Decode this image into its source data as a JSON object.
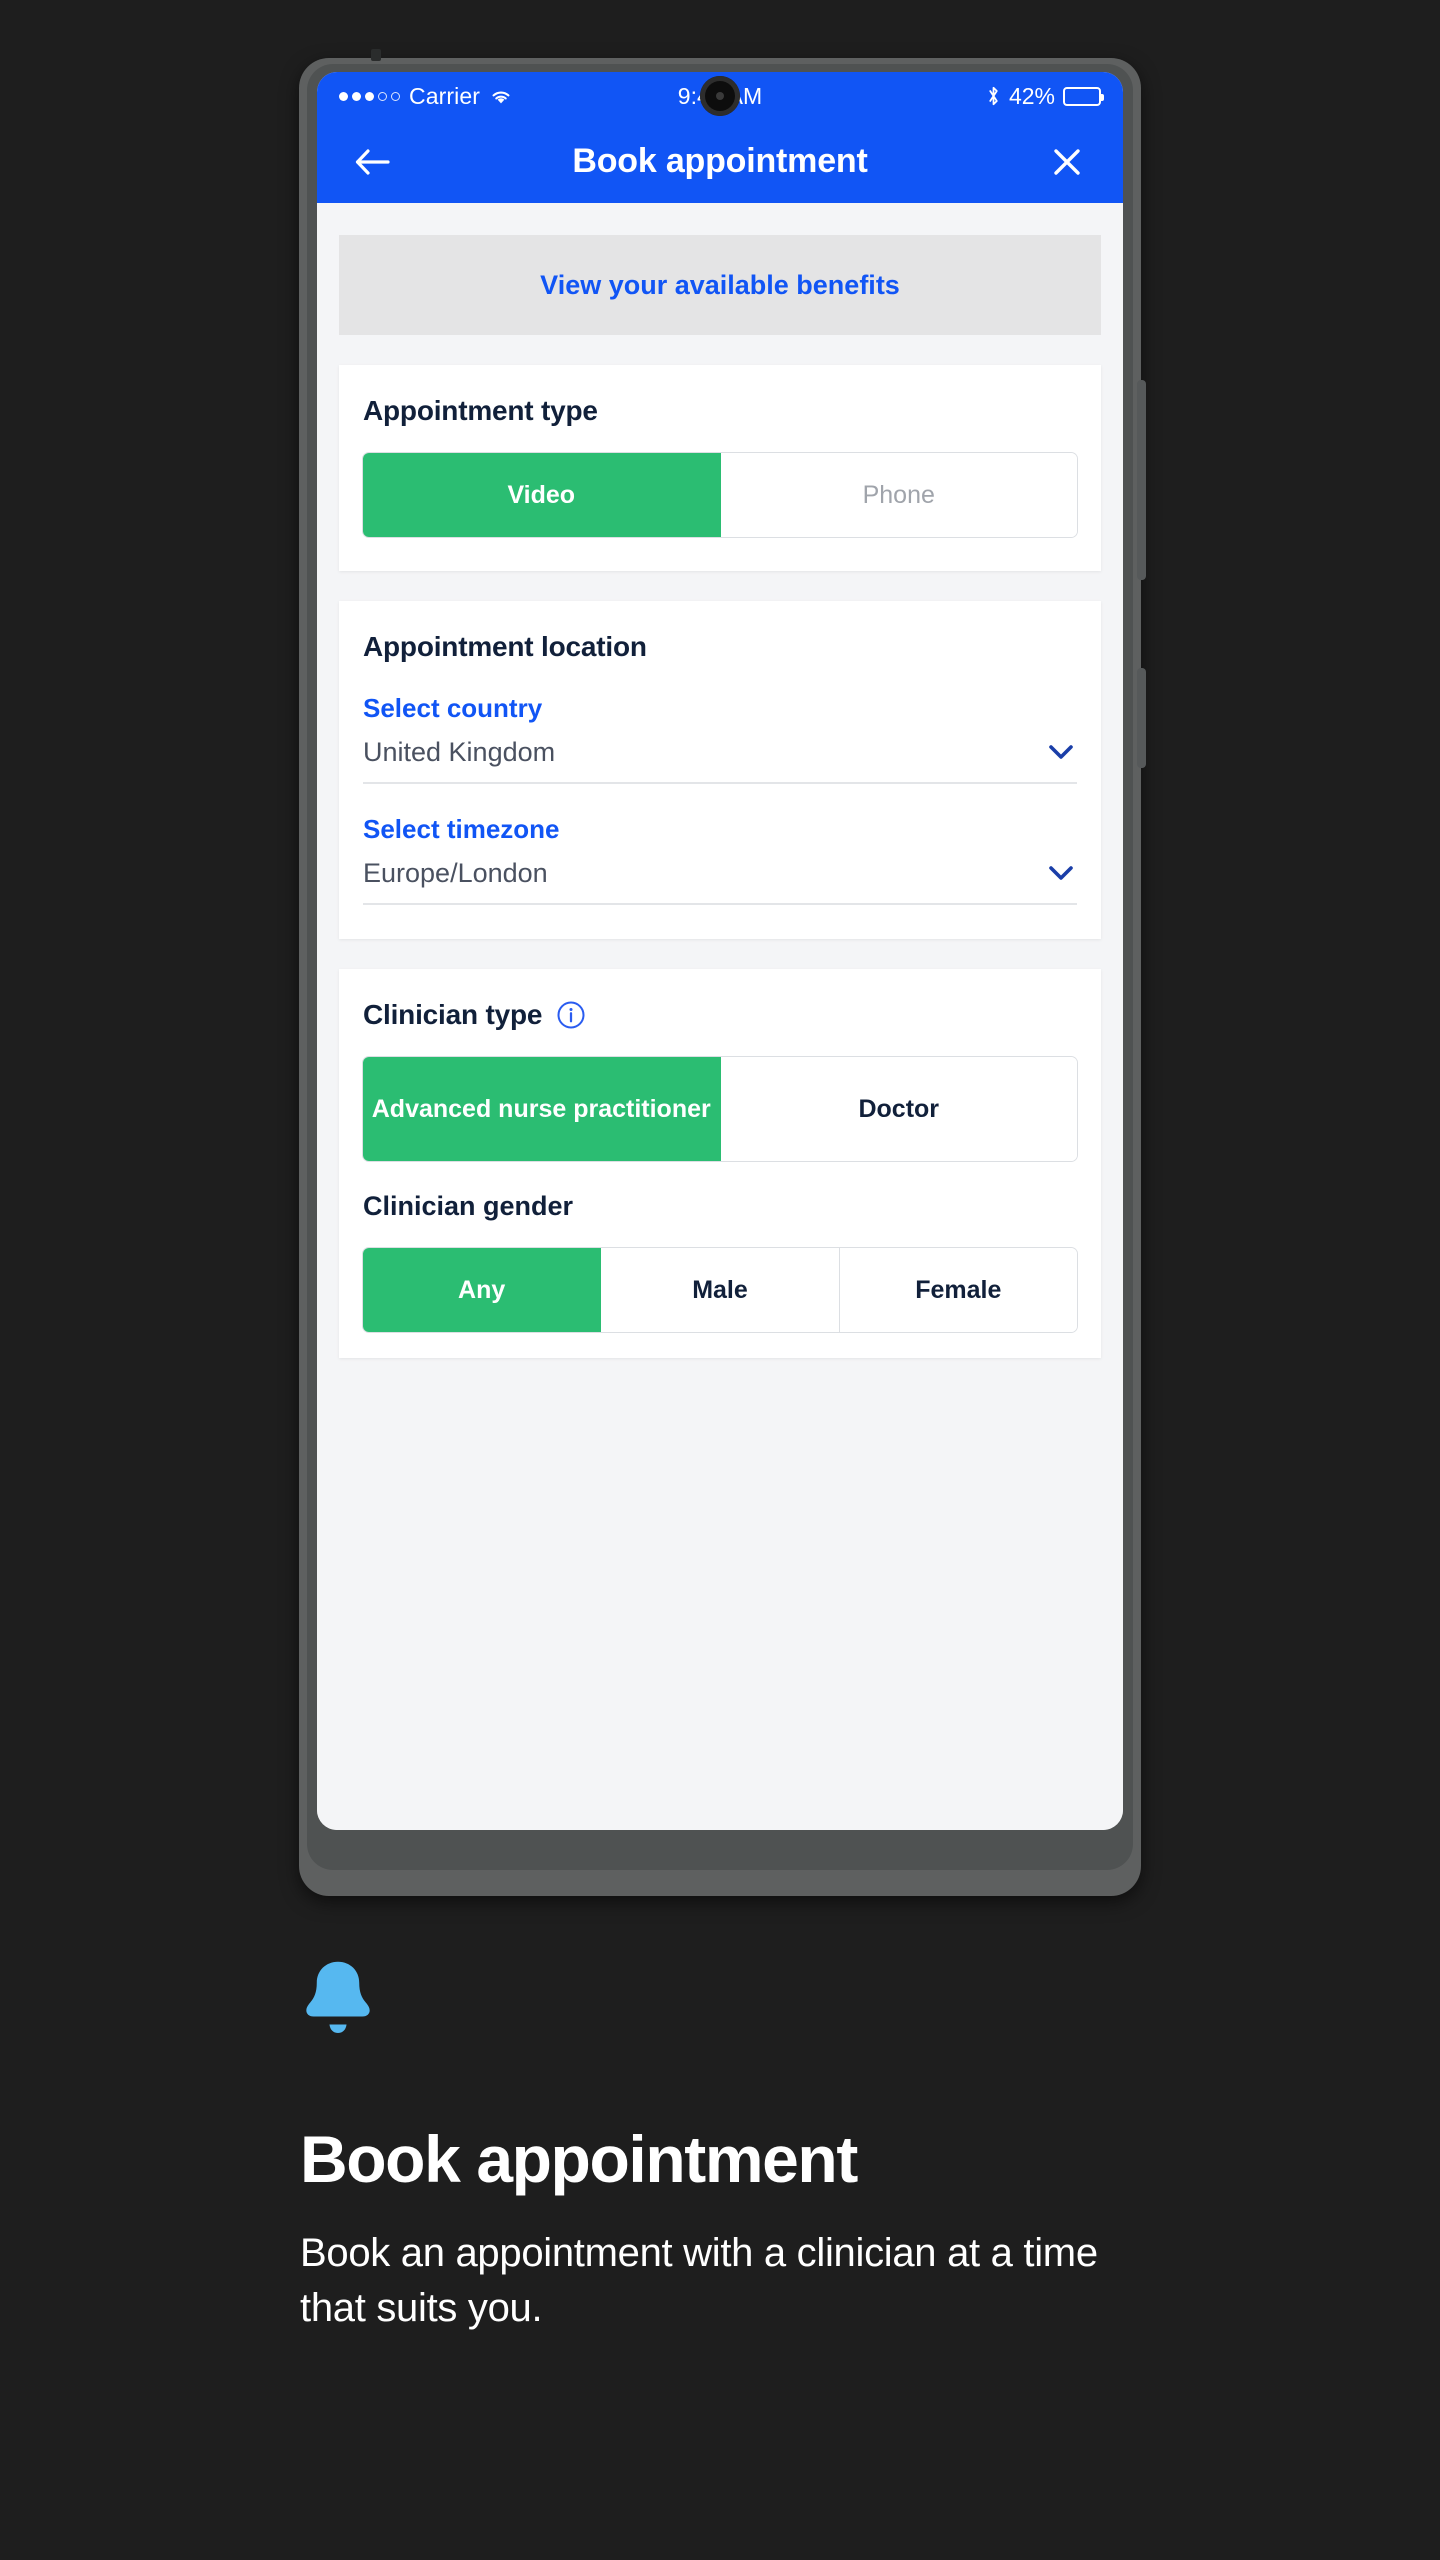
{
  "device": {
    "status_bar": {
      "signal_dots_filled": 3,
      "signal_dots_total": 5,
      "carrier": "Carrier",
      "wifi_icon": "wifi-icon",
      "time": "9:41 AM",
      "bluetooth_icon": "bluetooth-icon",
      "battery_percent": "42%",
      "battery_level": 42
    },
    "app_bar": {
      "back_icon": "arrow-left-icon",
      "title": "Book appointment",
      "close_icon": "close-icon"
    }
  },
  "screen": {
    "benefits_banner": {
      "label": "View your available benefits"
    },
    "appointment_type": {
      "title": "Appointment type",
      "options": [
        {
          "label": "Video",
          "selected": true
        },
        {
          "label": "Phone",
          "selected": false
        }
      ]
    },
    "appointment_location": {
      "title": "Appointment location",
      "country": {
        "label": "Select country",
        "value": "United Kingdom",
        "chevron_icon": "chevron-down-icon"
      },
      "timezone": {
        "label": "Select timezone",
        "value": "Europe/London",
        "chevron_icon": "chevron-down-icon"
      }
    },
    "clinician": {
      "type_title": "Clinician type",
      "type_info_icon": "info-circle-icon",
      "type_options": [
        {
          "label": "Advanced nurse practitioner",
          "selected": true
        },
        {
          "label": "Doctor",
          "selected": false
        }
      ],
      "gender_title": "Clinician gender",
      "gender_options": [
        {
          "label": "Any",
          "selected": true
        },
        {
          "label": "Male",
          "selected": false
        },
        {
          "label": "Female",
          "selected": false
        }
      ]
    }
  },
  "caption": {
    "bell_icon": "bell-icon",
    "title": "Book appointment",
    "body": "Book an appointment with a clinician at a time that suits you."
  },
  "colors": {
    "brand_blue": "#1155f5",
    "accent_green": "#2bbd72",
    "bell_blue": "#56b8f0",
    "page_background": "#1e1e1e",
    "app_background": "#f4f5f7",
    "heading_navy": "#11203a"
  }
}
